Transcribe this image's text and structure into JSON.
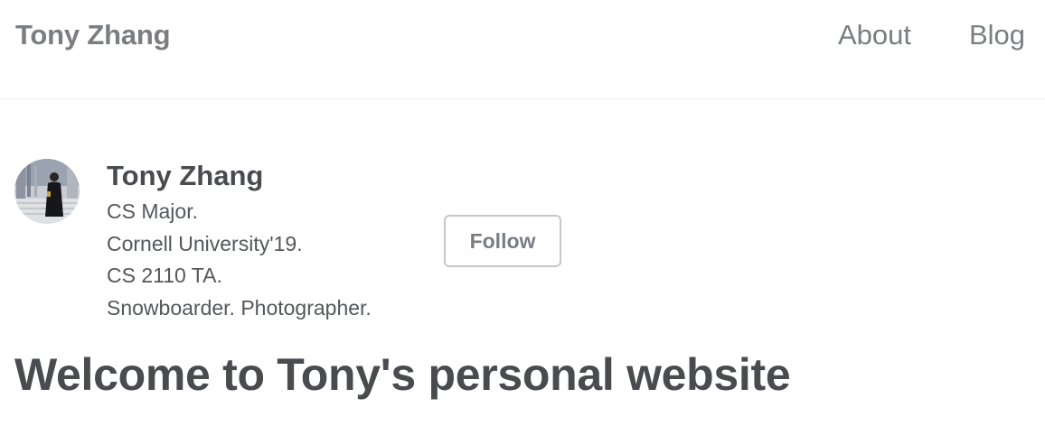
{
  "nav": {
    "brand": "Tony Zhang",
    "links": [
      {
        "label": "About"
      },
      {
        "label": "Blog"
      }
    ]
  },
  "profile": {
    "name": "Tony Zhang",
    "bio": [
      "CS Major.",
      "Cornell University'19.",
      "CS 2110 TA.",
      "Snowboarder. Photographer."
    ],
    "follow_label": "Follow",
    "avatar_icon": "profile-photo"
  },
  "page": {
    "title": "Welcome to Tony's personal website"
  }
}
